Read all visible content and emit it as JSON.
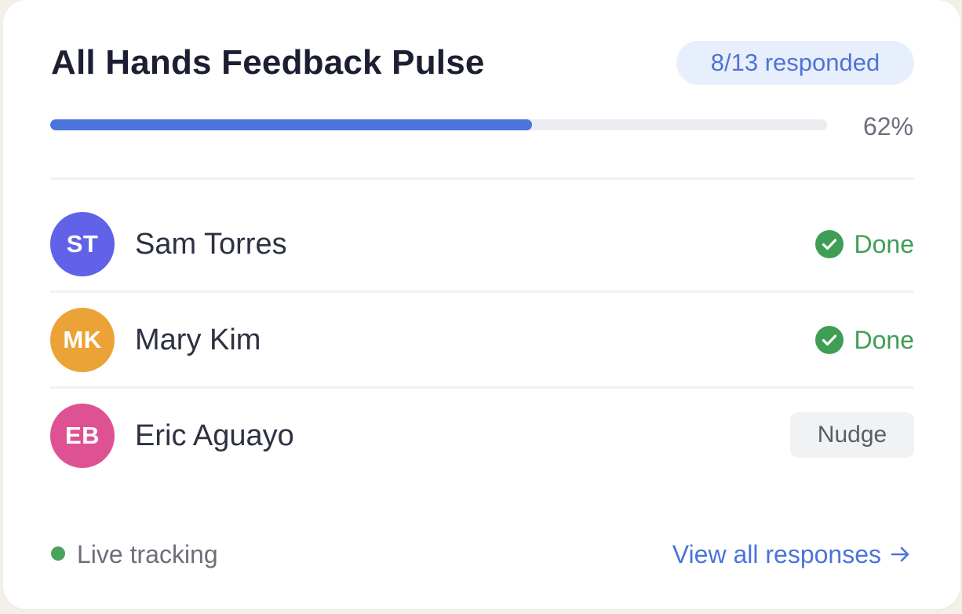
{
  "card": {
    "title": "All Hands Feedback Pulse",
    "badge": "8/13 responded",
    "progress": {
      "fraction": 0.62,
      "label": "62%"
    }
  },
  "colors": {
    "accent": "#4a74db",
    "done": "#3f9e54",
    "badge_bg": "#e8effc",
    "badge_text": "#4f73d4"
  },
  "respondents": [
    {
      "initials": "ST",
      "name": "Sam Torres",
      "avatar_color": "#6062e7",
      "status": "Done",
      "status_icon": "check-circle-icon"
    },
    {
      "initials": "MK",
      "name": "Mary Kim",
      "avatar_color": "#eba338",
      "status": "Done",
      "status_icon": "check-circle-icon"
    },
    {
      "initials": "EB",
      "name": "Eric Aguayo",
      "avatar_color": "#de5293",
      "action": "Nudge"
    }
  ],
  "footer": {
    "live_label": "Live tracking",
    "link_label": "View all responses",
    "link_icon": "arrow-right-icon"
  }
}
